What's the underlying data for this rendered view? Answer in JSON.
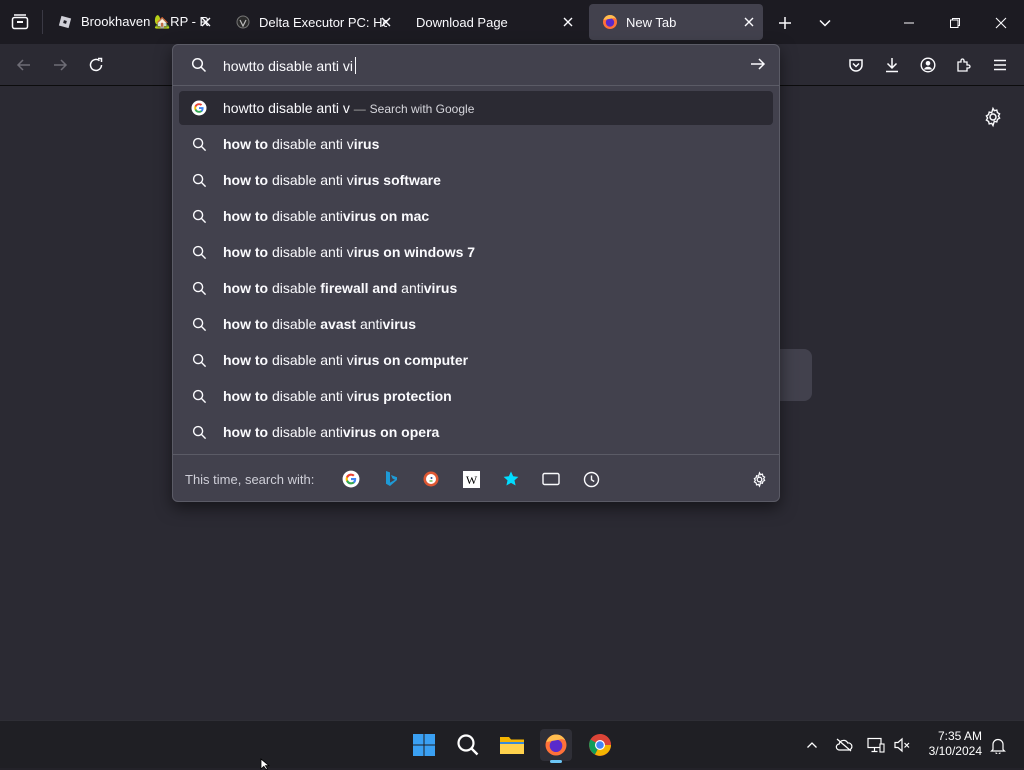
{
  "tabs": [
    {
      "label": "Brookhaven 🏡RP - Roblox",
      "icon": "roblox-icon"
    },
    {
      "label": "Delta Executor PC: How to",
      "icon": "delta-icon"
    },
    {
      "label": "Download Page",
      "icon": ""
    },
    {
      "label": "New Tab",
      "icon": "firefox-icon"
    }
  ],
  "urlbar": {
    "value": "howtto disable anti vi"
  },
  "suggestions": [
    {
      "type": "search",
      "prefix": "",
      "plain": "howtto disable anti v",
      "suffix": "Search with Google",
      "dash": "—"
    },
    {
      "b1": "how to",
      "t1": " disable anti v",
      "b2": "irus",
      "t2": "",
      "b3": ""
    },
    {
      "b1": "how to",
      "t1": " disable anti v",
      "b2": "irus software",
      "t2": "",
      "b3": ""
    },
    {
      "b1": "how to",
      "t1": " disable anti",
      "b2": "virus on mac",
      "t2": "",
      "b3": ""
    },
    {
      "b1": "how to",
      "t1": " disable anti v",
      "b2": "irus on windows 7",
      "t2": "",
      "b3": ""
    },
    {
      "b1": "how to",
      "t1": " disable ",
      "b2": "firewall and",
      "t2": " anti",
      "b3": "virus"
    },
    {
      "b1": "how to",
      "t1": " disable ",
      "b2": "avast",
      "t2": " anti",
      "b3": "virus"
    },
    {
      "b1": "how to",
      "t1": " disable anti v",
      "b2": "irus on computer",
      "t2": "",
      "b3": ""
    },
    {
      "b1": "how to",
      "t1": " disable anti v",
      "b2": "irus protection",
      "t2": "",
      "b3": ""
    },
    {
      "b1": "how to",
      "t1": " disable anti",
      "b2": "virus on opera",
      "t2": "",
      "b3": ""
    }
  ],
  "search_with": {
    "label": "This time, search with:",
    "engines": [
      "google-icon",
      "bing-icon",
      "duckduckgo-icon",
      "wikipedia-icon",
      "bookmarks-star-icon",
      "tabs-icon",
      "history-icon"
    ]
  },
  "taskbar": {
    "time": "7:35 AM",
    "date": "3/10/2024"
  },
  "colors": {
    "accent": "#00ddff",
    "panel": "#42414d",
    "toolbar": "#2b2a33"
  }
}
